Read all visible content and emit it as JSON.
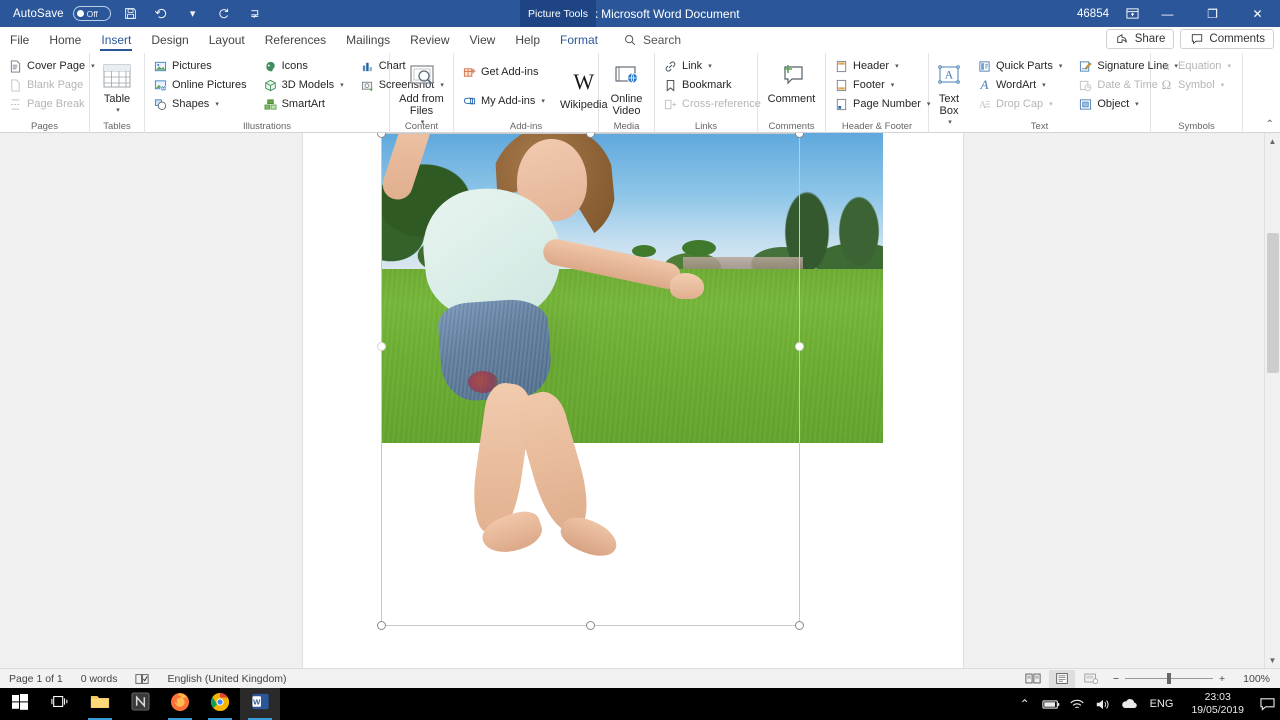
{
  "titlebar": {
    "autosave_label": "AutoSave",
    "autosave_state": "Off",
    "save_icon": "save-icon",
    "undo_icon": "undo-icon",
    "redo_icon": "redo-icon",
    "customize_icon": "customize-quick-access-icon",
    "document_title": "New Blank Microsoft Word Document",
    "context_tool": "Picture Tools",
    "user_name": "46854",
    "restore_icon": "restore-down-icon",
    "minimize_label": "—",
    "maximize_label": "❐",
    "close_label": "✕",
    "accent_color": "#2b579a"
  },
  "tabs": [
    {
      "label": "File",
      "active": false
    },
    {
      "label": "Home",
      "active": false
    },
    {
      "label": "Insert",
      "active": true
    },
    {
      "label": "Design",
      "active": false
    },
    {
      "label": "Layout",
      "active": false
    },
    {
      "label": "References",
      "active": false
    },
    {
      "label": "Mailings",
      "active": false
    },
    {
      "label": "Review",
      "active": false
    },
    {
      "label": "View",
      "active": false
    },
    {
      "label": "Help",
      "active": false
    },
    {
      "label": "Format",
      "active": false,
      "contextual": true
    }
  ],
  "search": {
    "label": "Search",
    "icon": "search-icon"
  },
  "tabbar_right": {
    "share_label": "Share",
    "share_icon": "share-icon",
    "comments_label": "Comments",
    "comments_icon": "comment-icon"
  },
  "ribbon": {
    "collapse_icon": "collapse-ribbon-icon",
    "groups": [
      {
        "name": "Pages",
        "label": "Pages",
        "items": [
          {
            "label": "Cover Page",
            "icon": "cover-page-icon",
            "caret": true,
            "disabled": false
          },
          {
            "label": "Blank Page",
            "icon": "blank-page-icon",
            "caret": false,
            "disabled": true
          },
          {
            "label": "Page Break",
            "icon": "page-break-icon",
            "caret": false,
            "disabled": true
          }
        ]
      },
      {
        "name": "Tables",
        "label": "Tables",
        "big": [
          {
            "label": "Table",
            "icon": "table-icon",
            "caret": true
          }
        ]
      },
      {
        "name": "Illustrations",
        "label": "Illustrations",
        "col1": [
          {
            "label": "Pictures",
            "icon": "pictures-icon",
            "caret": false,
            "disabled": false
          },
          {
            "label": "Online Pictures",
            "icon": "online-pictures-icon",
            "caret": false,
            "disabled": false
          },
          {
            "label": "Shapes",
            "icon": "shapes-icon",
            "caret": true,
            "disabled": false
          }
        ],
        "col2": [
          {
            "label": "Icons",
            "icon": "icons-icon",
            "caret": false,
            "disabled": false
          },
          {
            "label": "3D Models",
            "icon": "3d-models-icon",
            "caret": true,
            "disabled": false
          },
          {
            "label": "SmartArt",
            "icon": "smartart-icon",
            "caret": false,
            "disabled": false
          }
        ],
        "col3": [
          {
            "label": "Chart",
            "icon": "chart-icon",
            "caret": false,
            "disabled": false
          },
          {
            "label": "Screenshot",
            "icon": "screenshot-icon",
            "caret": true,
            "disabled": false
          }
        ]
      },
      {
        "name": "Content",
        "label": "Content",
        "big": [
          {
            "label": "Add from Files",
            "icon": "add-from-files-icon",
            "caret": true
          }
        ]
      },
      {
        "name": "Add-ins",
        "label": "Add-ins",
        "col1": [
          {
            "label": "Get Add-ins",
            "icon": "get-add-ins-icon",
            "caret": false,
            "disabled": false
          },
          {
            "label": "My Add-ins",
            "icon": "my-add-ins-icon",
            "caret": true,
            "disabled": false
          }
        ],
        "big": [
          {
            "label": "Wikipedia",
            "icon": "wikipedia-icon",
            "caret": false
          }
        ]
      },
      {
        "name": "Media",
        "label": "Media",
        "big": [
          {
            "label": "Online Video",
            "icon": "online-video-icon",
            "caret": false
          }
        ]
      },
      {
        "name": "Links",
        "label": "Links",
        "items": [
          {
            "label": "Link",
            "icon": "link-icon",
            "caret": true,
            "disabled": false
          },
          {
            "label": "Bookmark",
            "icon": "bookmark-icon",
            "caret": false,
            "disabled": false
          },
          {
            "label": "Cross-reference",
            "icon": "cross-reference-icon",
            "caret": false,
            "disabled": true
          }
        ]
      },
      {
        "name": "Comments",
        "label": "Comments",
        "big": [
          {
            "label": "Comment",
            "icon": "new-comment-icon",
            "caret": false
          }
        ]
      },
      {
        "name": "Header & Footer",
        "label": "Header & Footer",
        "items": [
          {
            "label": "Header",
            "icon": "header-icon",
            "caret": true,
            "disabled": false
          },
          {
            "label": "Footer",
            "icon": "footer-icon",
            "caret": true,
            "disabled": false
          },
          {
            "label": "Page Number",
            "icon": "page-number-icon",
            "caret": true,
            "disabled": false
          }
        ]
      },
      {
        "name": "Text",
        "label": "Text",
        "big": [
          {
            "label": "Text Box",
            "icon": "text-box-icon",
            "caret": true
          }
        ],
        "col1": [
          {
            "label": "Quick Parts",
            "icon": "quick-parts-icon",
            "caret": true,
            "disabled": false
          },
          {
            "label": "WordArt",
            "icon": "wordart-icon",
            "caret": true,
            "disabled": false
          },
          {
            "label": "Drop Cap",
            "icon": "drop-cap-icon",
            "caret": true,
            "disabled": true
          }
        ],
        "col2": [
          {
            "label": "Signature Line",
            "icon": "signature-line-icon",
            "caret": true,
            "disabled": false
          },
          {
            "label": "Date & Time",
            "icon": "date-and-time-icon",
            "caret": false,
            "disabled": true
          },
          {
            "label": "Object",
            "icon": "object-icon",
            "caret": true,
            "disabled": false
          }
        ]
      },
      {
        "name": "Symbols",
        "label": "Symbols",
        "items": [
          {
            "label": "Equation",
            "icon": "equation-icon",
            "caret": true,
            "disabled": true
          },
          {
            "label": "Symbol",
            "icon": "symbol-icon",
            "caret": true,
            "disabled": true
          }
        ]
      }
    ]
  },
  "document": {
    "picture": {
      "name": "jumping-girl-photo",
      "alt_description": "Young girl jumping on a green lawn with trees and blue sky",
      "selected": true,
      "handles": 8
    },
    "cursor": "move-resize-cursor",
    "scrollbar": {
      "up_arrow": "▲",
      "down_arrow": "▼"
    }
  },
  "statusbar": {
    "page": "Page 1 of 1",
    "words": "0 words",
    "proofing_icon": "proofing-errors-icon",
    "language": "English (United Kingdom)",
    "view_read_icon": "read-mode-icon",
    "view_print_icon": "print-layout-icon",
    "view_web_icon": "web-layout-icon",
    "zoom_out": "−",
    "zoom_in": "+",
    "zoom_level": "100%"
  },
  "taskbar": {
    "apps": [
      {
        "name": "start-button",
        "icon": "windows-logo-icon",
        "active": false,
        "running": false
      },
      {
        "name": "task-view-button",
        "icon": "task-view-icon",
        "active": false,
        "running": false
      },
      {
        "name": "file-explorer",
        "icon": "file-explorer-icon",
        "active": false,
        "running": true
      },
      {
        "name": "notepad-app",
        "icon": "notes-app-icon",
        "active": false,
        "running": false
      },
      {
        "name": "firefox",
        "icon": "firefox-icon",
        "active": false,
        "running": true
      },
      {
        "name": "chrome",
        "icon": "chrome-icon",
        "active": false,
        "running": true
      },
      {
        "name": "word",
        "icon": "word-icon",
        "active": true,
        "running": true
      }
    ],
    "tray": {
      "show_hidden_icon": "chevron-up-icon",
      "battery_icon": "battery-icon",
      "wifi_icon": "wifi-icon",
      "volume_icon": "volume-icon",
      "onedrive_icon": "onedrive-icon",
      "language": "ENG",
      "time": "23:03",
      "date": "19/05/2019",
      "notification_icon": "action-center-icon"
    }
  }
}
